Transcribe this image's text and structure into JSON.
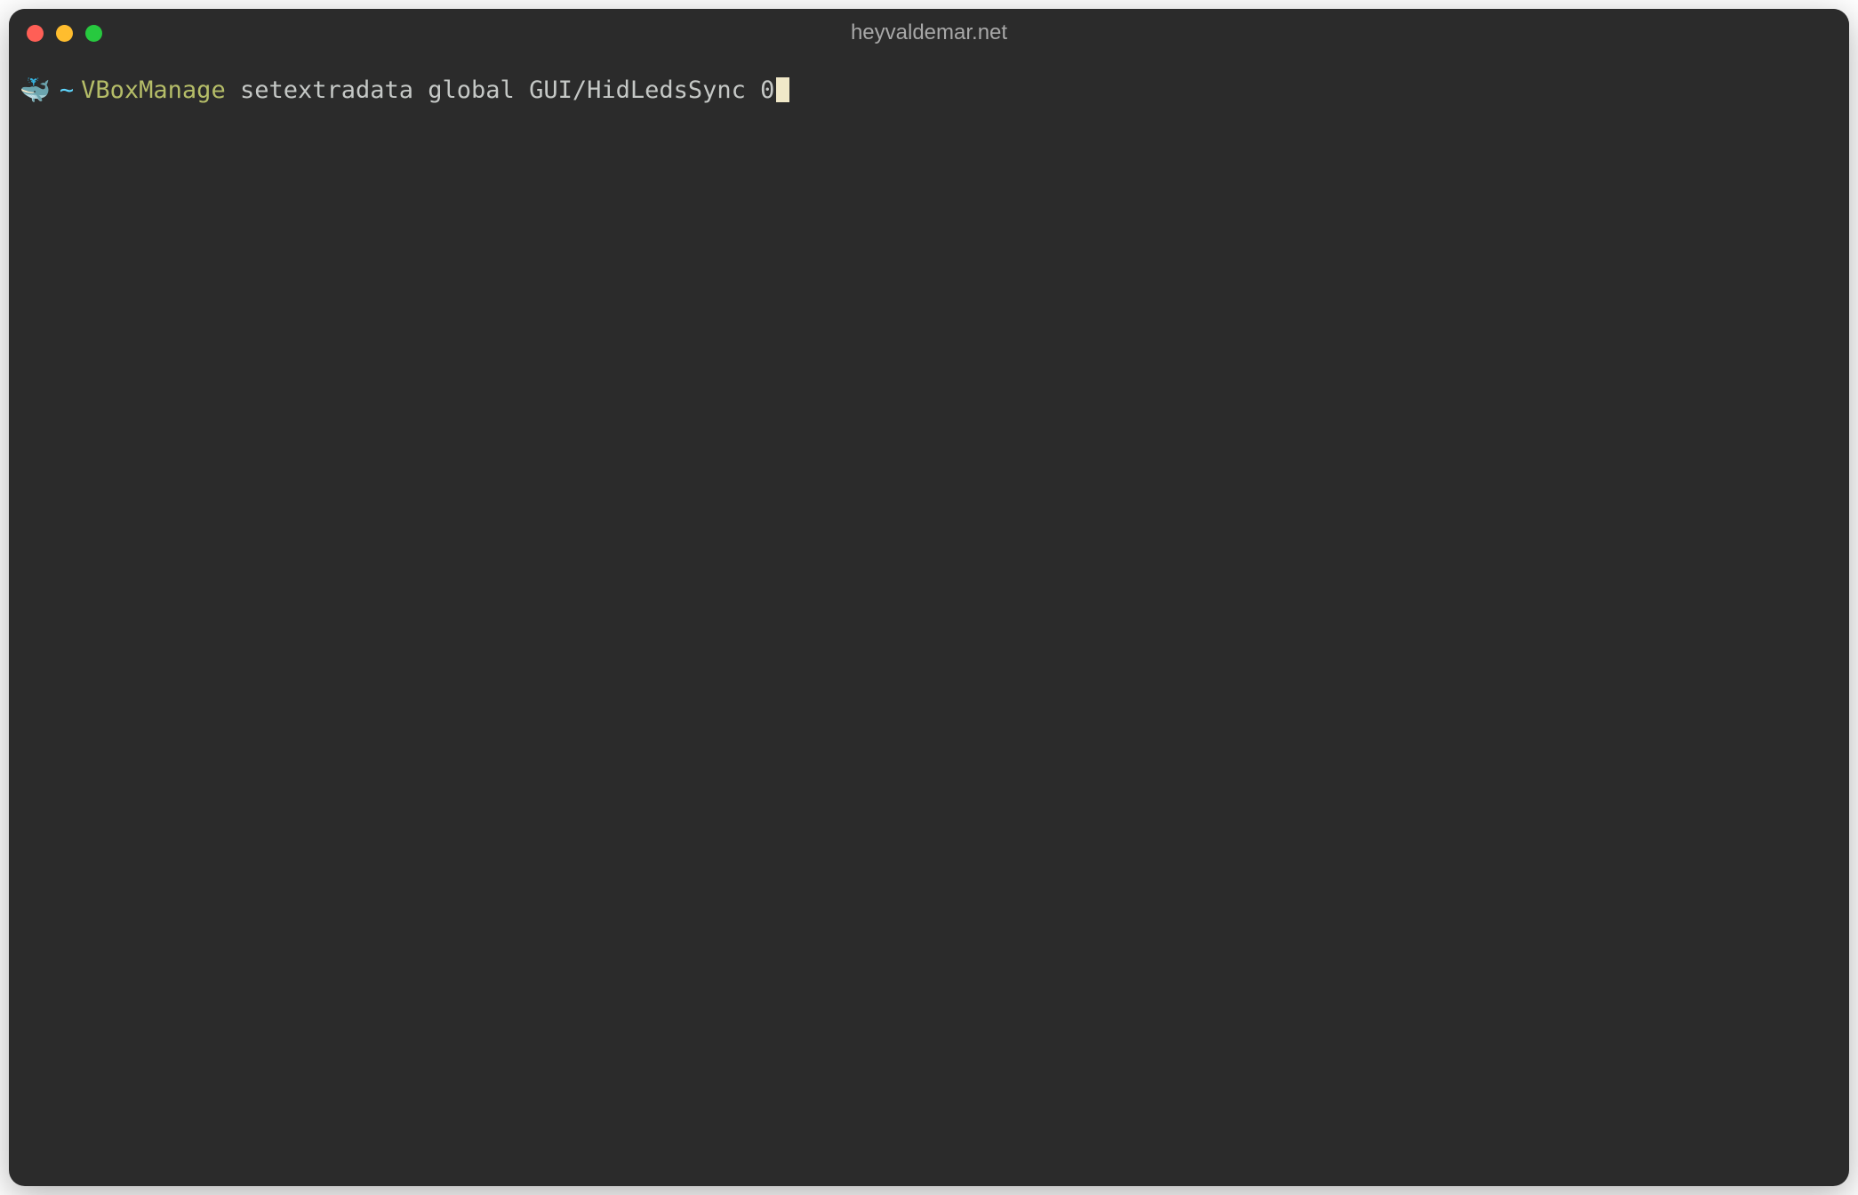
{
  "window": {
    "title": "heyvaldemar.net"
  },
  "prompt": {
    "icon": "🐳",
    "tilde": "~",
    "command": "VBoxManage",
    "args": " setextradata global GUI/HidLedsSync 0"
  }
}
